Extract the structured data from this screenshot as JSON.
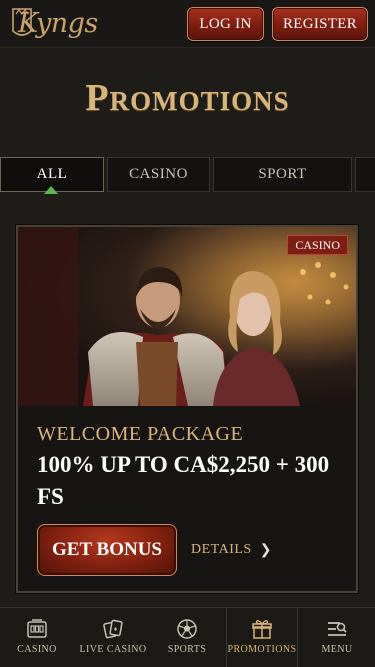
{
  "header": {
    "logo_text": "Kyngs",
    "login_label": "LOG IN",
    "register_label": "REGISTER"
  },
  "page": {
    "title": "Promotions"
  },
  "tabs": [
    {
      "label": "ALL",
      "active": true
    },
    {
      "label": "CASINO",
      "active": false
    },
    {
      "label": "SPORT",
      "active": false
    }
  ],
  "promotion": {
    "badge": "CASINO",
    "subtitle": "WELCOME PACKAGE",
    "title": "100% UP TO CA$2,250 + 300 FS",
    "cta_label": "GET BONUS",
    "details_label": "DETAILS"
  },
  "bottom_nav": [
    {
      "label": "CASINO",
      "icon": "casino-icon"
    },
    {
      "label": "LIVE CASINO",
      "icon": "cards-icon"
    },
    {
      "label": "SPORTS",
      "icon": "ball-icon"
    },
    {
      "label": "PROMOTIONS",
      "icon": "gift-icon",
      "active": true
    },
    {
      "label": "MENU",
      "icon": "menu-icon"
    }
  ],
  "colors": {
    "gold": "#d9b57a",
    "button_red": "#7d1d10",
    "background": "#1f1d1a",
    "active_indicator": "#5fb84f"
  }
}
